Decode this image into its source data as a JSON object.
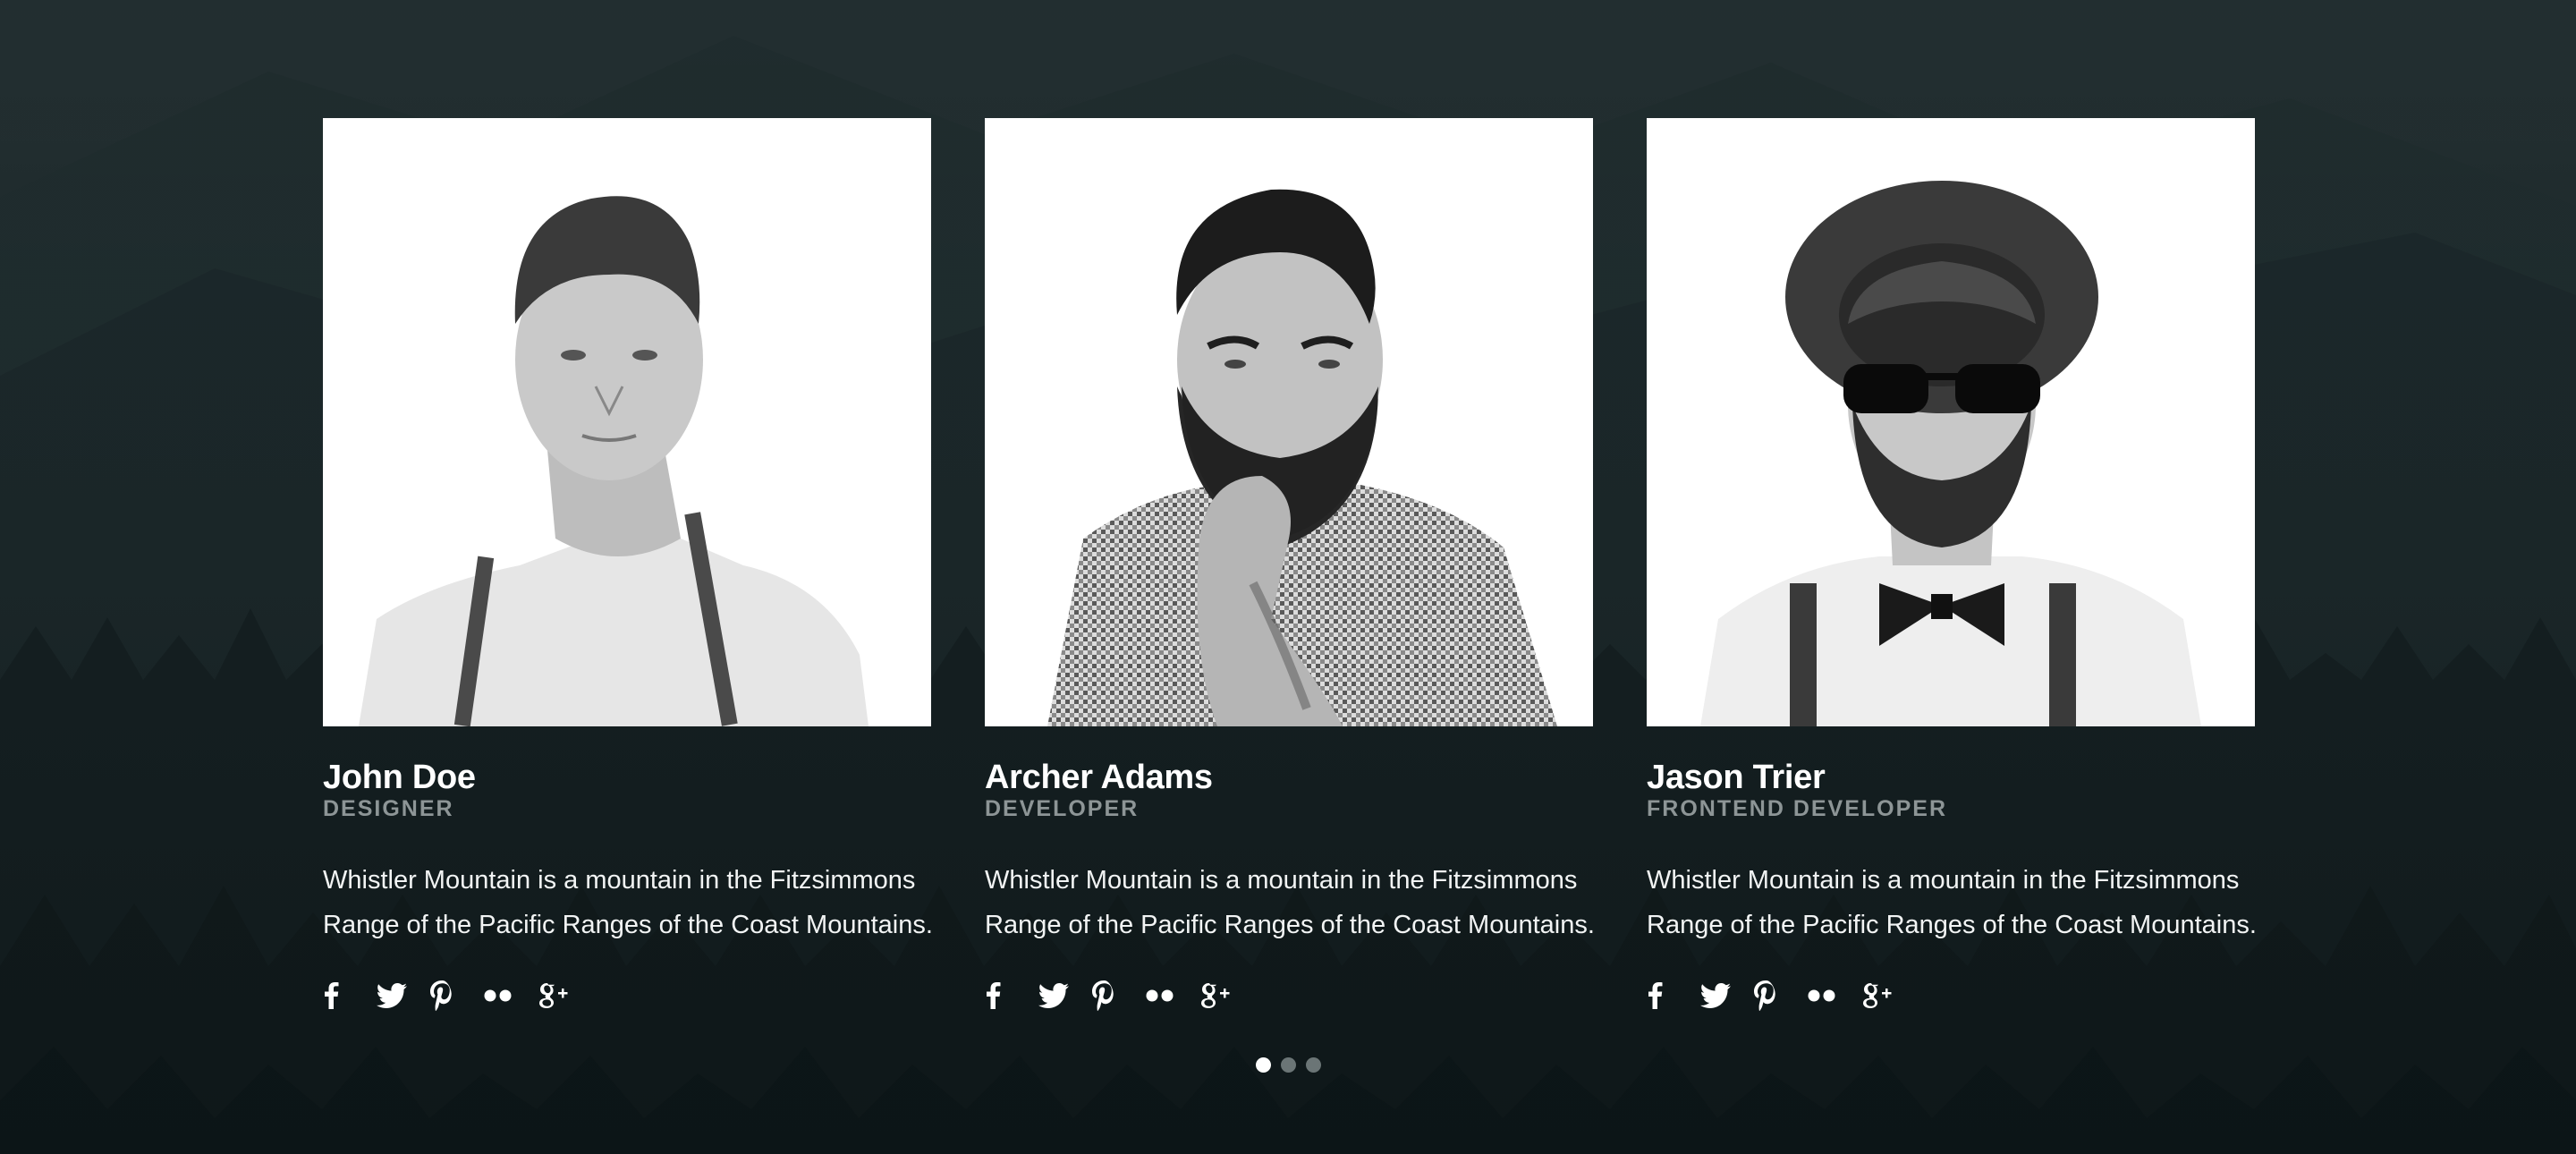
{
  "colors": {
    "background": "#1a2628",
    "card_photo_bg": "#ffffff",
    "role_text": "#8d9596",
    "dot_inactive": "#6b7576",
    "dot_active": "#ffffff"
  },
  "team": {
    "members": [
      {
        "name": "John Doe",
        "role": "DESIGNER",
        "bio": "Whistler Mountain is a mountain in the Fitzsimmons Range of the Pacific Ranges of the Coast Mountains.",
        "photo_icon": "portrait-photo"
      },
      {
        "name": "Archer Adams",
        "role": "DEVELOPER",
        "bio": "Whistler Mountain is a mountain in the Fitzsimmons Range of the Pacific Ranges of the Coast Mountains.",
        "photo_icon": "portrait-photo"
      },
      {
        "name": "Jason Trier",
        "role": "FRONTEND DEVELOPER",
        "bio": "Whistler Mountain is a mountain in the Fitzsimmons Range of the Pacific Ranges of the Coast Mountains.",
        "photo_icon": "portrait-photo"
      }
    ],
    "social_icons": [
      "facebook-icon",
      "twitter-icon",
      "pinterest-icon",
      "flickr-icon",
      "google-plus-icon"
    ]
  },
  "carousel": {
    "pages": 3,
    "active_page": 1
  }
}
